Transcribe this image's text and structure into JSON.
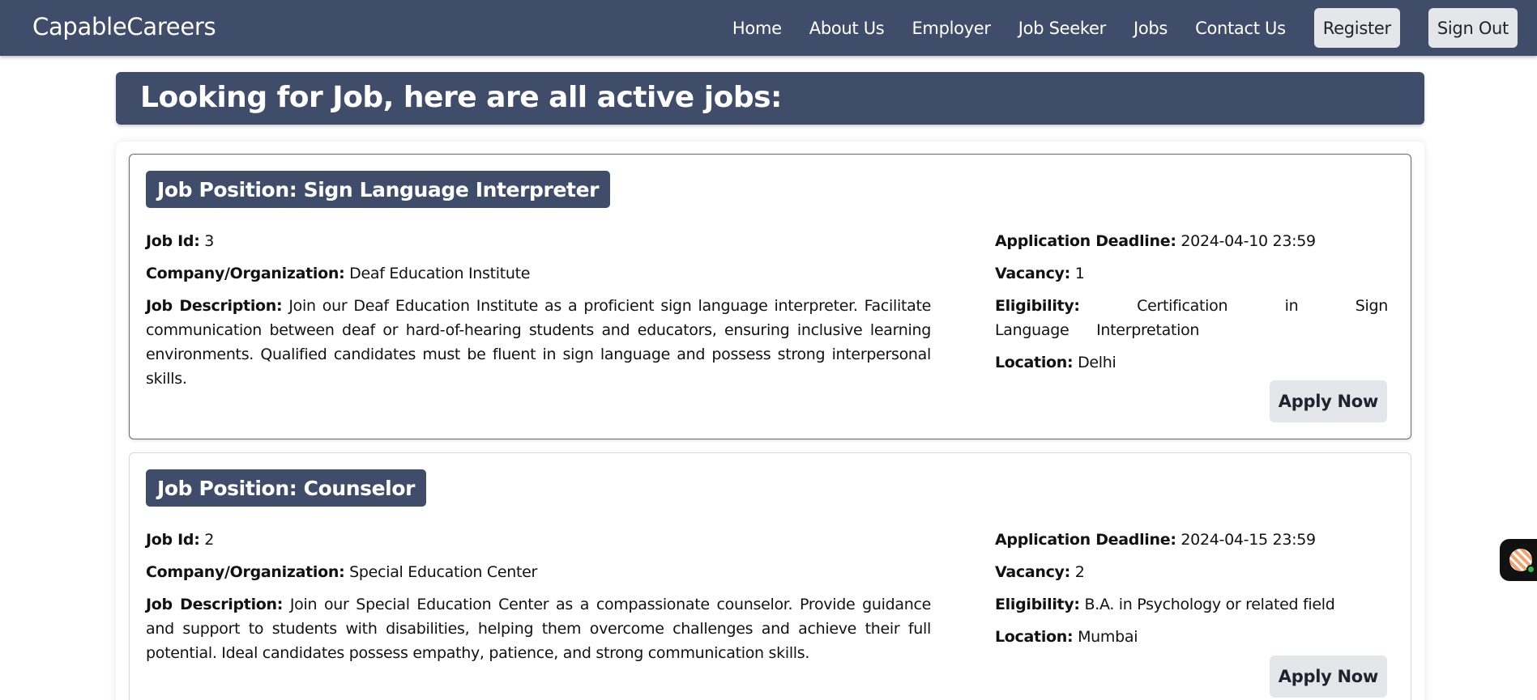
{
  "navbar": {
    "brand": "CapableCareers",
    "links": [
      "Home",
      "About Us",
      "Employer",
      "Job Seeker",
      "Jobs",
      "Contact Us"
    ],
    "register_label": "Register",
    "signout_label": "Sign Out"
  },
  "page_heading": "Looking for Job, here are all active jobs:",
  "labels": {
    "job_id": "Job Id:",
    "company": "Company/Organization:",
    "description": "Job Description:",
    "deadline": "Application Deadline:",
    "vacancy": "Vacancy:",
    "eligibility": "Eligibility:",
    "location": "Location:",
    "apply": "Apply Now"
  },
  "jobs": [
    {
      "position": "Job Position: Sign Language Interpreter",
      "job_id": "3",
      "company": "Deaf Education Institute",
      "description": "Join our Deaf Education Institute as a proficient sign language interpreter. Facilitate communication between deaf or hard-of-hearing students and educators, ensuring inclusive learning environments. Qualified candidates must be fluent in sign language and possess strong interpersonal skills.",
      "deadline": "2024-04-10 23:59",
      "vacancy": "1",
      "eligibility": "Certification in Sign Language Interpretation",
      "location": "Delhi"
    },
    {
      "position": "Job Position: Counselor",
      "job_id": "2",
      "company": "Special Education Center",
      "description": "Join our Special Education Center as a compassionate counselor. Provide guidance and support to students with disabilities, helping them overcome challenges and achieve their full potential. Ideal candidates possess empathy, patience, and strong communication skills.",
      "deadline": "2024-04-15 23:59",
      "vacancy": "2",
      "eligibility": "B.A. in Psychology or related field",
      "location": "Mumbai"
    }
  ],
  "colors": {
    "primary": "#3f4d6b",
    "button_bg": "#e4e6ea",
    "chat_status": "#27c24c"
  },
  "icons": {
    "chat_widget": "chat-assistant-icon"
  }
}
